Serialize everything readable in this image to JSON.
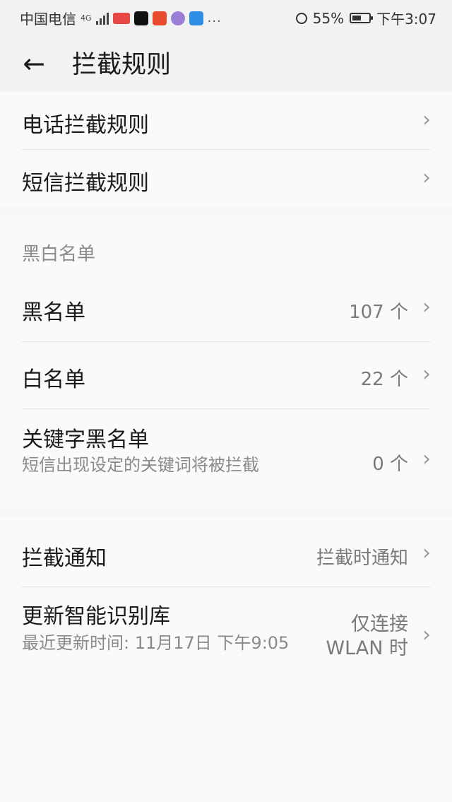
{
  "status_bar": {
    "carrier": "中国电信",
    "network": "4G",
    "battery_text": "55%",
    "battery_level": 0.55,
    "time": "下午3:07",
    "more_icon": "..."
  },
  "header": {
    "title": "拦截规则",
    "back_glyph": "←"
  },
  "rules": {
    "call_rules": "电话拦截规则",
    "sms_rules": "短信拦截规则"
  },
  "lists": {
    "section_label": "黑白名单",
    "blacklist": {
      "label": "黑名单",
      "count": "107 个"
    },
    "whitelist": {
      "label": "白名单",
      "count": "22 个"
    },
    "keyword_blacklist": {
      "label": "关键字黑名单",
      "description": "短信出现设定的关键词将被拦截",
      "count": "0 个"
    }
  },
  "settings": {
    "notify": {
      "label": "拦截通知",
      "value": "拦截时通知"
    },
    "update_db": {
      "label": "更新智能识别库",
      "last_update": "最近更新时间: 11月17日 下午9:05",
      "value_line1": "仅连接",
      "value_line2": "WLAN 时"
    }
  },
  "chevron": "›"
}
